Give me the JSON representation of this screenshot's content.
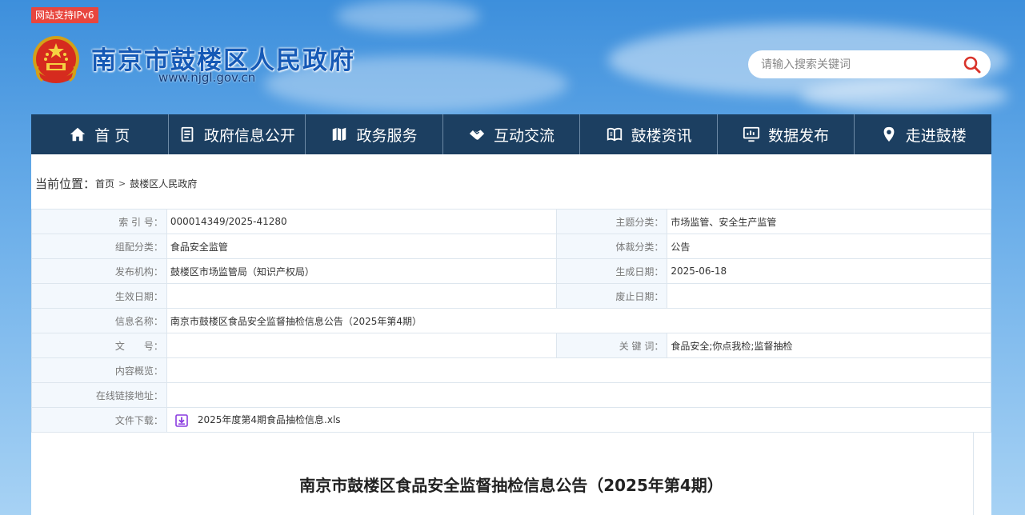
{
  "header": {
    "ipv6_badge": "网站支持IPv6",
    "site_name": "南京市鼓楼区人民政府",
    "site_url": "www.njgl.gov.cn",
    "search_placeholder": "请输入搜索关键词"
  },
  "nav": {
    "items": [
      {
        "label": "首 页",
        "icon": "home-icon"
      },
      {
        "label": "政府信息公开",
        "icon": "document-icon"
      },
      {
        "label": "政务服务",
        "icon": "map-icon"
      },
      {
        "label": "互动交流",
        "icon": "handshake-icon"
      },
      {
        "label": "鼓楼资讯",
        "icon": "book-icon"
      },
      {
        "label": "数据发布",
        "icon": "monitor-chart-icon"
      },
      {
        "label": "走进鼓楼",
        "icon": "location-pin-icon"
      }
    ]
  },
  "breadcrumb": {
    "prefix": "当前位置：",
    "items": [
      "首页",
      "鼓楼区人民政府"
    ],
    "separator": ">"
  },
  "meta": {
    "index_label": "索 引 号：",
    "index_value": "000014349/2025-41280",
    "topic_label": "主题分类：",
    "topic_value": "市场监管、安全生产监管",
    "org_cat_label": "组配分类：",
    "org_cat_value": "食品安全监管",
    "genre_label": "体裁分类：",
    "genre_value": "公告",
    "publisher_label": "发布机构：",
    "publisher_value": "鼓楼区市场监管局（知识产权局）",
    "created_label": "生成日期：",
    "created_value": "2025-06-18",
    "effective_label": "生效日期：",
    "effective_value": "",
    "repeal_label": "废止日期：",
    "repeal_value": "",
    "name_label": "信息名称：",
    "name_value": "南京市鼓楼区食品安全监督抽检信息公告（2025年第4期）",
    "docno_label": "文　　号：",
    "docno_value": "",
    "keywords_label": "关 键 词：",
    "keywords_value": "食品安全;你点我检;监督抽检",
    "summary_label": "内容概览：",
    "summary_value": "",
    "link_label": "在线链接地址：",
    "link_value": "",
    "download_label": "文件下载：",
    "download_file": "2025年度第4期食品抽检信息.xls"
  },
  "article": {
    "title": "南京市鼓楼区食品安全监督抽检信息公告（2025年第4期）"
  },
  "colors": {
    "nav_bg": "#1c3f61",
    "label_bg": "#f3f8fd",
    "badge_red": "#e8463e",
    "site_name_blue": "#1559b6",
    "download_purple": "#8a3ce0"
  }
}
